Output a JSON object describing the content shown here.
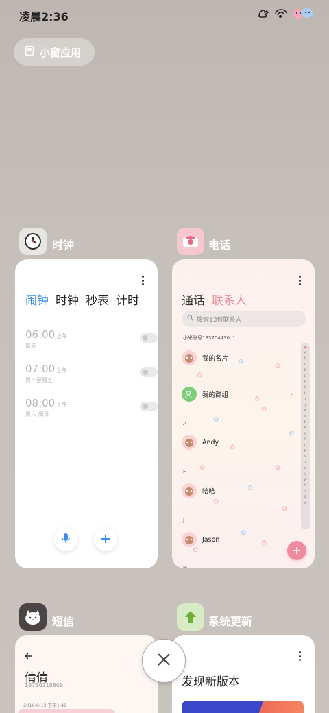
{
  "status_bar": {
    "time": "凌晨2:36"
  },
  "small_window_button": {
    "label": "小窗应用"
  },
  "clock_app": {
    "name": "时钟",
    "tabs": [
      {
        "label": "闹钟",
        "active": true
      },
      {
        "label": "时钟",
        "active": false
      },
      {
        "label": "秒表",
        "active": false
      },
      {
        "label": "计时",
        "active": false
      }
    ],
    "alarms": [
      {
        "time": "06:00",
        "period": "上午",
        "repeat": "每天",
        "enabled": false
      },
      {
        "time": "07:00",
        "period": "上午",
        "repeat": "周一至周五",
        "enabled": false
      },
      {
        "time": "08:00",
        "period": "上午",
        "repeat": "周六 周日",
        "enabled": false
      }
    ]
  },
  "phone_app": {
    "name": "电话",
    "tabs": [
      {
        "label": "通话",
        "active": false
      },
      {
        "label": "联系人",
        "active": true
      }
    ],
    "search_placeholder": "搜索13位联系人",
    "account_label": "小米账号183704430",
    "contacts": [
      {
        "section": "",
        "name": "我的名片"
      },
      {
        "section": "",
        "name": "我的群组"
      },
      {
        "section": "A",
        "name": "Andy"
      },
      {
        "section": "H",
        "name": "哈哈"
      },
      {
        "section": "J",
        "name": "Jason"
      }
    ],
    "bottom_letter": "M",
    "index_letters": [
      "A",
      "B",
      "C",
      "D",
      "E",
      "F",
      "G",
      "H",
      "I",
      "J",
      "K",
      "L",
      "M",
      "N",
      "O",
      "P",
      "Q",
      "R",
      "S",
      "T",
      "U",
      "V",
      "W",
      "X",
      "Y",
      "Z",
      "#"
    ],
    "accent_color": "#f08aa0"
  },
  "sms_app": {
    "name": "短信",
    "contact_name": "倩倩",
    "contact_number": "18730218809",
    "timestamp": "2016-6-13 下午1:49"
  },
  "update_app": {
    "name": "系统更新",
    "headline": "发现新版本"
  },
  "colors": {
    "clock_accent": "#3a8ee6",
    "phone_accent": "#f08aa0"
  }
}
